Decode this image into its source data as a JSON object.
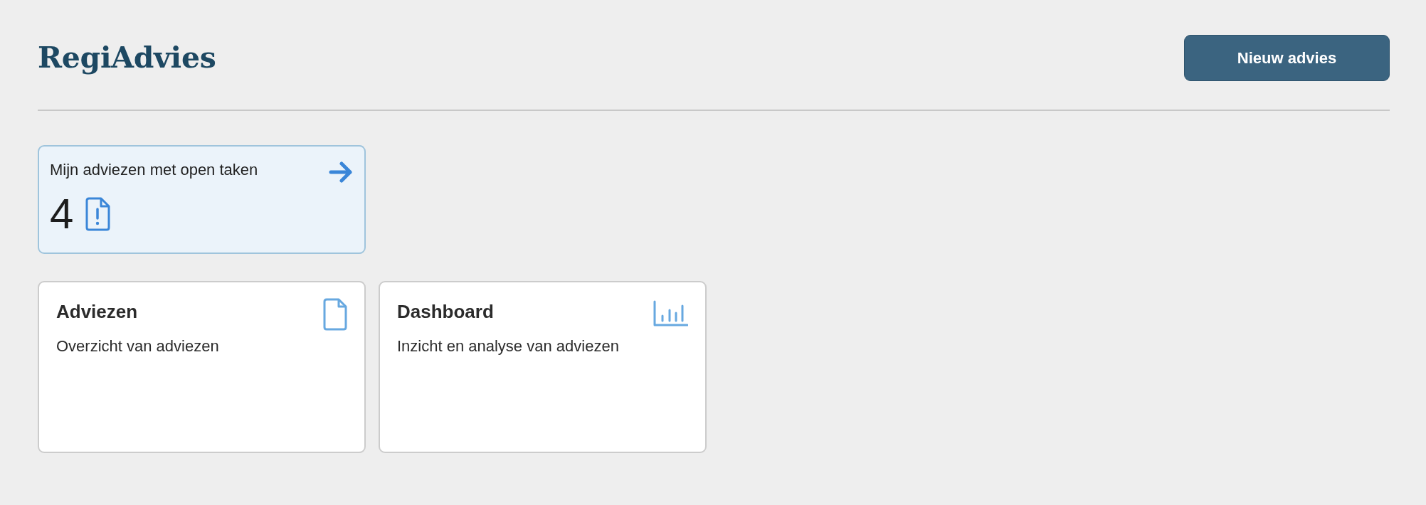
{
  "header": {
    "title": "RegiAdvies",
    "button": "Nieuw advies"
  },
  "summary_card": {
    "title": "Mijn adviezen met open taken",
    "count": "4"
  },
  "tiles": [
    {
      "kind": "document",
      "title": "Adviezen",
      "description": "Overzicht van adviezen"
    },
    {
      "kind": "chart",
      "title": "Dashboard",
      "description": "Inzicht en analyse van adviezen"
    }
  ]
}
